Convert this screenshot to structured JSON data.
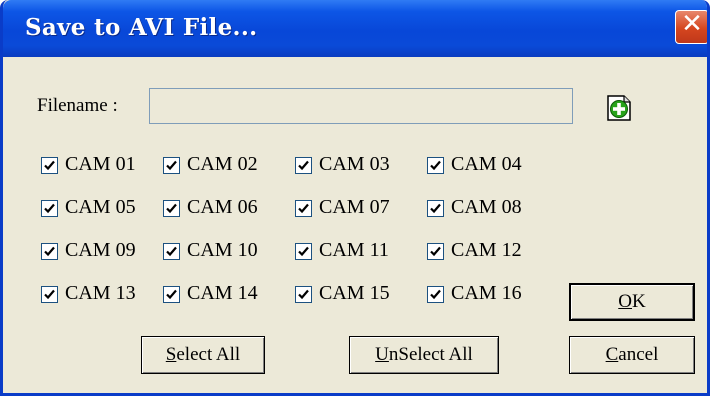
{
  "window": {
    "title": "Save to AVI File...",
    "close_glyph": "✕"
  },
  "filename": {
    "label": "Filename :",
    "value": "",
    "placeholder": "",
    "add_icon": "add-file-icon"
  },
  "cameras": [
    {
      "label": "CAM 01",
      "checked": true
    },
    {
      "label": "CAM 02",
      "checked": true
    },
    {
      "label": "CAM 03",
      "checked": true
    },
    {
      "label": "CAM 04",
      "checked": true
    },
    {
      "label": "CAM 05",
      "checked": true
    },
    {
      "label": "CAM 06",
      "checked": true
    },
    {
      "label": "CAM 07",
      "checked": true
    },
    {
      "label": "CAM 08",
      "checked": true
    },
    {
      "label": "CAM 09",
      "checked": true
    },
    {
      "label": "CAM 10",
      "checked": true
    },
    {
      "label": "CAM 11",
      "checked": true
    },
    {
      "label": "CAM 12",
      "checked": true
    },
    {
      "label": "CAM 13",
      "checked": true
    },
    {
      "label": "CAM 14",
      "checked": true
    },
    {
      "label": "CAM 15",
      "checked": true
    },
    {
      "label": "CAM 16",
      "checked": true
    }
  ],
  "buttons": {
    "ok": {
      "label": "OK",
      "accel": "O",
      "rest": "K"
    },
    "select_all": {
      "label": "Select All",
      "accel": "S",
      "rest": "elect All"
    },
    "unselect_all": {
      "label": "UnSelect All",
      "accel": "U",
      "rest": "nSelect All"
    },
    "cancel": {
      "label": "Cancel",
      "accel": "C",
      "rest": "ancel"
    }
  }
}
